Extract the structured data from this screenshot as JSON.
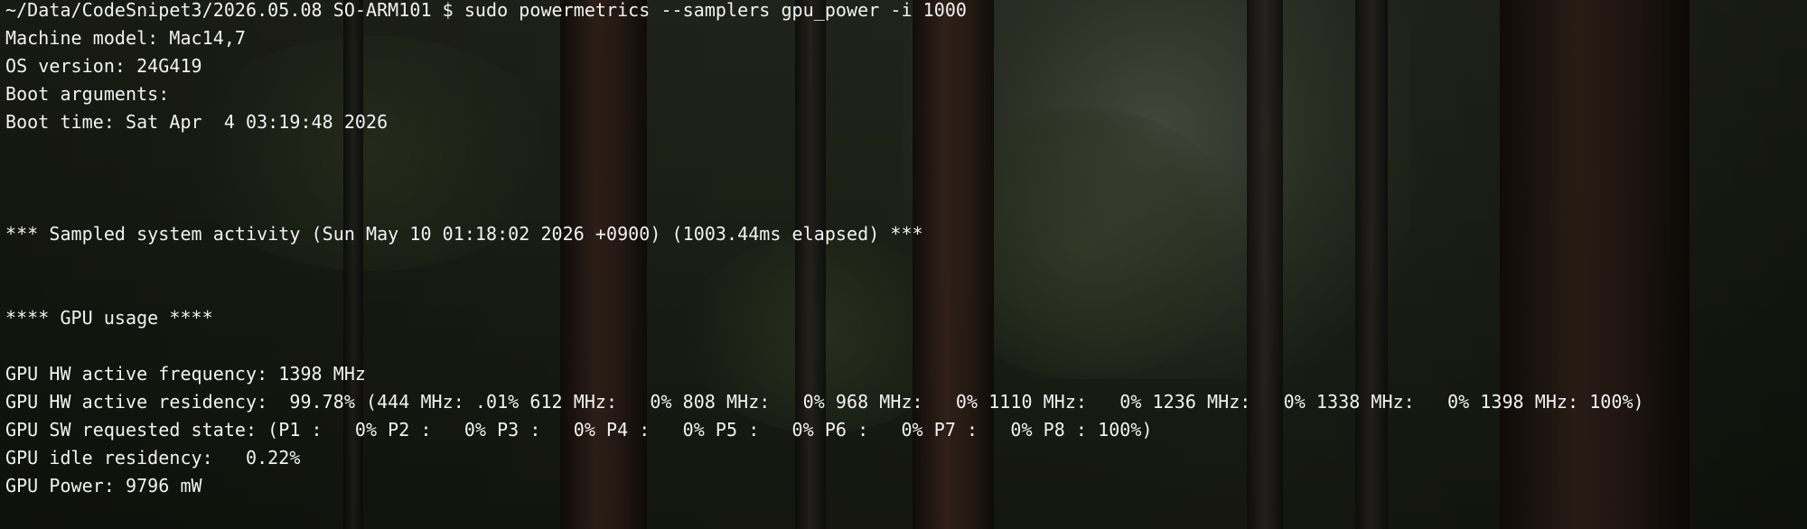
{
  "terminal": {
    "lines": [
      {
        "kind": "command",
        "text": "~/Data/CodeSnipet3/2026.05.08 SO-ARM101 $ sudo powermetrics --samplers gpu_power -i 1000"
      },
      {
        "kind": "output",
        "text": "Machine model: Mac14,7"
      },
      {
        "kind": "output",
        "text": "OS version: 24G419"
      },
      {
        "kind": "output",
        "text": "Boot arguments:"
      },
      {
        "kind": "output",
        "text": "Boot time: Sat Apr  4 03:19:48 2026"
      },
      {
        "kind": "blank",
        "text": ""
      },
      {
        "kind": "blank",
        "text": ""
      },
      {
        "kind": "blank",
        "text": ""
      },
      {
        "kind": "output",
        "text": "*** Sampled system activity (Sun May 10 01:18:02 2026 +0900) (1003.44ms elapsed) ***"
      },
      {
        "kind": "blank",
        "text": ""
      },
      {
        "kind": "blank",
        "text": ""
      },
      {
        "kind": "output",
        "text": "**** GPU usage ****"
      },
      {
        "kind": "blank",
        "text": ""
      },
      {
        "kind": "output",
        "text": "GPU HW active frequency: 1398 MHz"
      },
      {
        "kind": "output",
        "text": "GPU HW active residency:  99.78% (444 MHz: .01% 612 MHz:   0% 808 MHz:   0% 968 MHz:   0% 1110 MHz:   0% 1236 MHz:   0% 1338 MHz:   0% 1398 MHz: 100%)"
      },
      {
        "kind": "output",
        "text": "GPU SW requested state: (P1 :   0% P2 :   0% P3 :   0% P4 :   0% P5 :   0% P6 :   0% P7 :   0% P8 : 100%)"
      },
      {
        "kind": "output",
        "text": "GPU idle residency:   0.22%"
      },
      {
        "kind": "output",
        "text": "GPU Power: 9796 mW"
      }
    ]
  },
  "colors": {
    "text": "#f2f2f2",
    "background": "#22261a"
  }
}
